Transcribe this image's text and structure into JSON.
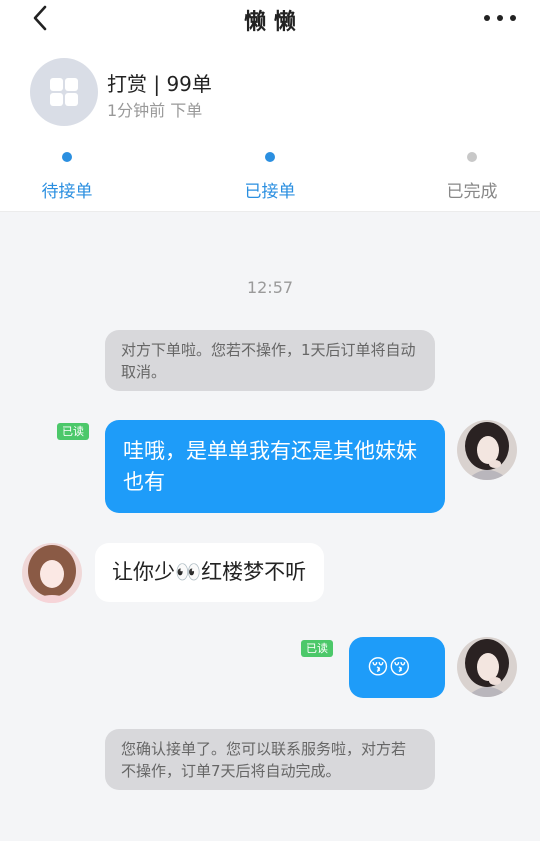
{
  "header": {
    "title": "懒 懒",
    "back_icon": "chevron-left-icon",
    "more_icon": "more-dots-icon"
  },
  "order": {
    "icon": "app-grid-icon",
    "title": "打赏 | 99单",
    "time": "1分钟前 下单"
  },
  "steps": [
    {
      "label": "待接单",
      "color": "#2b8fe0",
      "dot_color": "#2b8fe0"
    },
    {
      "label": "已接单",
      "color": "#2b8fe0",
      "dot_color": "#2b8fe0"
    },
    {
      "label": "已完成",
      "color": "#888888",
      "dot_color": "#c8c8c8"
    }
  ],
  "chat": {
    "timestamp": "12:57",
    "messages": [
      {
        "type": "system",
        "text": "对方下单啦。您若不操作，1天后订单将自动取消。"
      },
      {
        "type": "out",
        "read_label": "已读",
        "text": "哇哦，是单单我有还是其他妹妹也有"
      },
      {
        "type": "in",
        "text": "让你少👀红楼梦不听"
      },
      {
        "type": "out",
        "read_label": "已读",
        "text": "😚😚"
      },
      {
        "type": "system",
        "text": "您确认接单了。您可以联系服务啦，对方若不操作，订单7天后将自动完成。"
      }
    ]
  },
  "colors": {
    "accent": "#2b8fe0",
    "bubble_out": "#1e9cf9",
    "read_badge": "#4cc86a",
    "system_bubble": "#d8d8db"
  }
}
